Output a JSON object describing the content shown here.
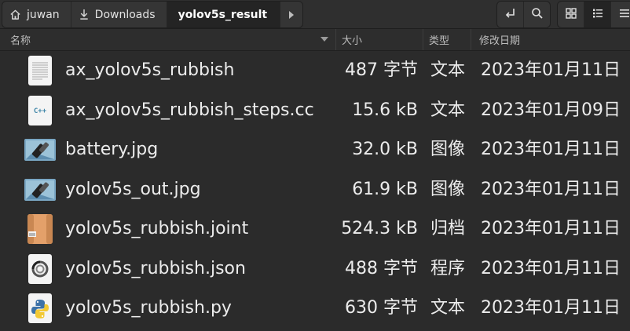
{
  "breadcrumb": {
    "home_label": "juwan",
    "downloads_label": "Downloads",
    "current_label": "yolov5s_result"
  },
  "columns": {
    "name": "名称",
    "size": "大小",
    "type": "类型",
    "modified": "修改日期"
  },
  "files": [
    {
      "name": "ax_yolov5s_rubbish",
      "size": "487 字节",
      "type": "文本",
      "modified": "2023年01月11日",
      "icon": "text-file-icon"
    },
    {
      "name": "ax_yolov5s_rubbish_steps.cc",
      "size": "15.6 kB",
      "type": "文本",
      "modified": "2023年01月09日",
      "icon": "cpp-file-icon"
    },
    {
      "name": "battery.jpg",
      "size": "32.0 kB",
      "type": "图像",
      "modified": "2023年01月11日",
      "icon": "image-file-icon"
    },
    {
      "name": "yolov5s_out.jpg",
      "size": "61.9 kB",
      "type": "图像",
      "modified": "2023年01月11日",
      "icon": "image-file-icon"
    },
    {
      "name": "yolov5s_rubbish.joint",
      "size": "524.3 kB",
      "type": "归档",
      "modified": "2023年01月11日",
      "icon": "archive-file-icon"
    },
    {
      "name": "yolov5s_rubbish.json",
      "size": "488 字节",
      "type": "程序",
      "modified": "2023年01月11日",
      "icon": "json-file-icon"
    },
    {
      "name": "yolov5s_rubbish.py",
      "size": "630 字节",
      "type": "文本",
      "modified": "2023年01月11日",
      "icon": "python-file-icon"
    }
  ],
  "colors": {
    "background": "#2b2b2b",
    "toolbar": "#2f2f2f",
    "text": "#ececec"
  }
}
